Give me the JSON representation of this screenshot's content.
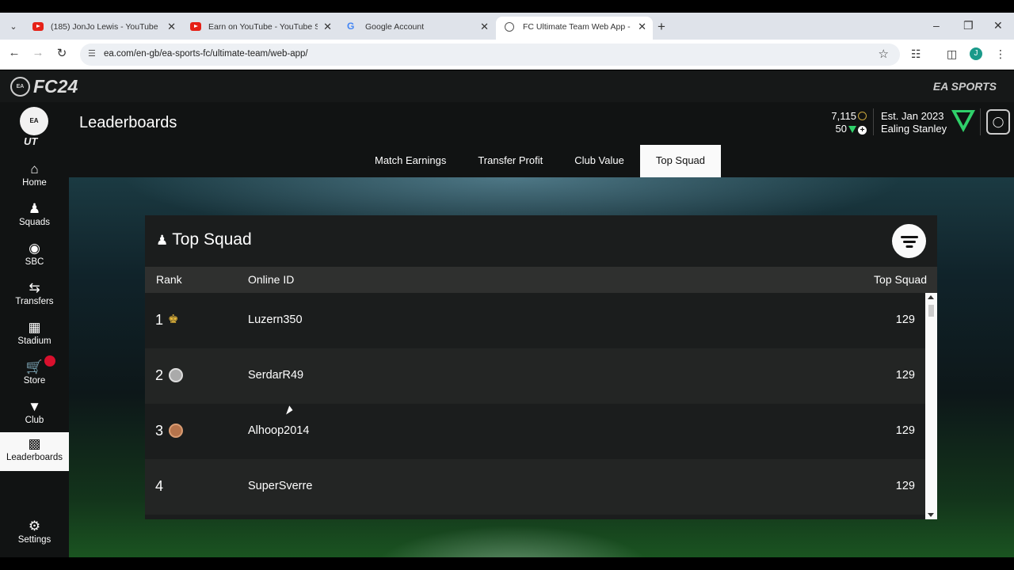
{
  "browser": {
    "tabs": [
      {
        "title": "(185) JonJo Lewis - YouTube",
        "favicon": "youtube-icon"
      },
      {
        "title": "Earn on YouTube - YouTube Stu",
        "favicon": "youtube-icon"
      },
      {
        "title": "Google Account",
        "favicon": "google-icon"
      },
      {
        "title": "FC Ultimate Team Web App - E/",
        "favicon": "globe-icon",
        "active": true
      }
    ],
    "url": "ea.com/en-gb/ea-sports-fc/ultimate-team/web-app/",
    "profile_initial": "J"
  },
  "brand": {
    "logo": "FC24",
    "ea_badge": "EA",
    "publisher": "EA SPORTS"
  },
  "sidebar": {
    "logo_badge": "EA",
    "logo_text": "UT",
    "items": [
      {
        "label": "Home",
        "icon": "home-icon"
      },
      {
        "label": "Squads",
        "icon": "squads-icon"
      },
      {
        "label": "SBC",
        "icon": "sbc-icon"
      },
      {
        "label": "Transfers",
        "icon": "transfers-icon"
      },
      {
        "label": "Stadium",
        "icon": "stadium-icon"
      },
      {
        "label": "Store",
        "icon": "store-icon"
      },
      {
        "label": "Club",
        "icon": "club-icon"
      },
      {
        "label": "Leaderboards",
        "icon": "leaderboards-icon",
        "active": true
      },
      {
        "label": "Settings",
        "icon": "gear-icon"
      }
    ]
  },
  "header": {
    "title": "Leaderboards",
    "coins": "7,115",
    "points": "50",
    "club_est": "Est. Jan 2023",
    "club_name": "Ealing Stanley"
  },
  "subtabs": [
    {
      "label": "Match Earnings"
    },
    {
      "label": "Transfer Profit"
    },
    {
      "label": "Club Value"
    },
    {
      "label": "Top Squad",
      "active": true
    }
  ],
  "leaderboard": {
    "title": "Top Squad",
    "columns": {
      "rank": "Rank",
      "online_id": "Online ID",
      "value": "Top Squad"
    },
    "rows": [
      {
        "rank": "1",
        "medal": "crown-icon",
        "online_id": "Luzern350",
        "value": "129"
      },
      {
        "rank": "2",
        "medal": "silver-medal-icon",
        "online_id": "SerdarR49",
        "value": "129"
      },
      {
        "rank": "3",
        "medal": "bronze-medal-icon",
        "online_id": "Alhoop2014",
        "value": "129"
      },
      {
        "rank": "4",
        "medal": "",
        "online_id": "SuperSverre",
        "value": "129"
      }
    ]
  },
  "colors": {
    "accent_green": "#2fd06a",
    "coin_gold": "#c9a53c",
    "store_badge": "#d9102d"
  }
}
